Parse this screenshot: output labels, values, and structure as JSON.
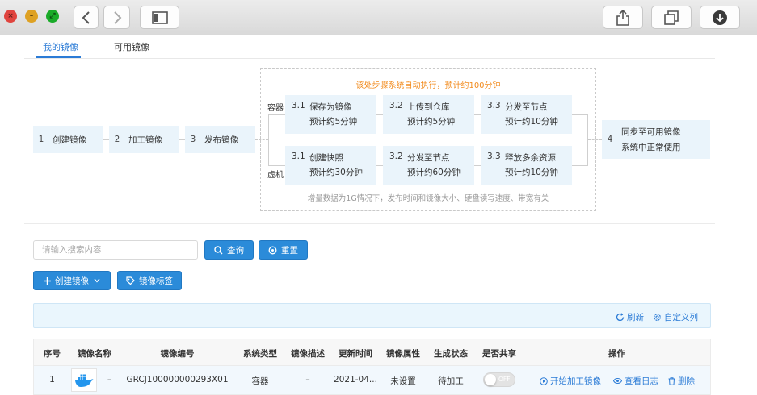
{
  "tabs": [
    {
      "label": "我的镜像",
      "active": true
    },
    {
      "label": "可用镜像",
      "active": false
    }
  ],
  "flow": {
    "steps": [
      {
        "num": "1",
        "label": "创建镜像"
      },
      {
        "num": "2",
        "label": "加工镜像"
      },
      {
        "num": "3",
        "label": "发布镜像"
      }
    ],
    "notice": "该处步骤系统自动执行，预计约100分钟",
    "container_label": "容器",
    "vm_label": "虚机",
    "container_steps": [
      {
        "num": "3.1",
        "line1": "保存为镜像",
        "line2": "预计约5分钟"
      },
      {
        "num": "3.2",
        "line1": "上传到仓库",
        "line2": "预计约5分钟"
      },
      {
        "num": "3.3",
        "line1": "分发至节点",
        "line2": "预计约10分钟"
      }
    ],
    "vm_steps": [
      {
        "num": "3.1",
        "line1": "创建快照",
        "line2": "预计约30分钟"
      },
      {
        "num": "3.2",
        "line1": "分发至节点",
        "line2": "预计约60分钟"
      },
      {
        "num": "3.3",
        "line1": "释放多余资源",
        "line2": "预计约10分钟"
      }
    ],
    "hint": "增量数据为1G情况下，发布时间和镜像大小、硬盘读写速度、带宽有关",
    "final": {
      "num": "4",
      "line1": "同步至可用镜像",
      "line2": "系统中正常使用"
    }
  },
  "search": {
    "placeholder": "请输入搜索内容",
    "value": "",
    "query_label": "查询",
    "reset_label": "重置"
  },
  "toolbar": {
    "create_label": "创建镜像",
    "tags_label": "镜像标签"
  },
  "infobar": {
    "refresh_label": "刷新",
    "custom_columns_label": "自定义列"
  },
  "table": {
    "headers": [
      "序号",
      "镜像名称",
      "镜像编号",
      "系统类型",
      "镜像描述",
      "更新时间",
      "镜像属性",
      "生成状态",
      "是否共享",
      "操作"
    ],
    "rows": [
      {
        "index": "1",
        "name": "–",
        "code": "GRCJ100000000293X01",
        "system_type": "容器",
        "description": "–",
        "updated": "2021-04...",
        "attribute": "未设置",
        "status": "待加工",
        "share_toggle": "OFF",
        "actions": {
          "start": "开始加工镜像",
          "log": "查看日志",
          "delete": "删除"
        }
      }
    ]
  },
  "icons": {
    "thumbnail": "docker-whale-icon"
  },
  "colors": {
    "primary": "#2b8bd9",
    "link": "#2b7bd6",
    "notice": "#f28b1d",
    "step_bg": "#eaf4fb"
  }
}
